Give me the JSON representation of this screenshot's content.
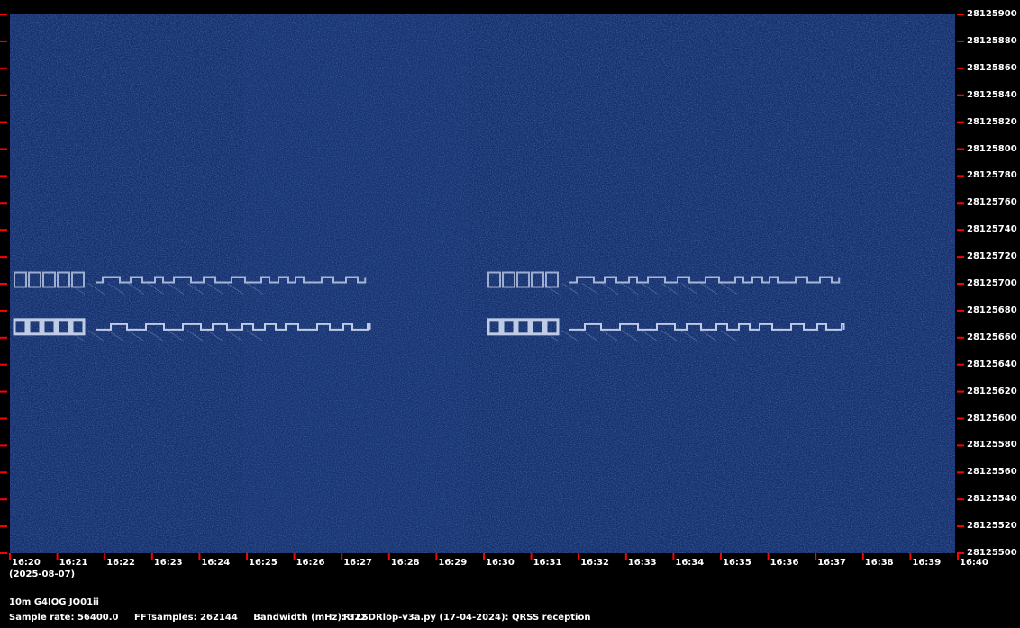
{
  "chart_data": {
    "type": "heatmap",
    "title": "",
    "xlabel": "",
    "ylabel": "",
    "x_tick_labels": [
      "16:20",
      "16:21",
      "16:22",
      "16:23",
      "16:24",
      "16:25",
      "16:26",
      "16:27",
      "16:28",
      "16:29",
      "16:30",
      "16:31",
      "16:32",
      "16:33",
      "16:34",
      "16:35",
      "16:36",
      "16:37",
      "16:38",
      "16:39",
      "16:40"
    ],
    "x_range": [
      "16:20",
      "16:40"
    ],
    "date": "(2025-08-07)",
    "y_tick_labels": [
      "28125900",
      "28125880",
      "28125860",
      "28125840",
      "28125820",
      "28125800",
      "28125780",
      "28125760",
      "28125740",
      "28125720",
      "28125700",
      "28125680",
      "28125660",
      "28125640",
      "28125620",
      "28125600",
      "28125580",
      "28125560",
      "28125540",
      "28125520",
      "28125500"
    ],
    "y_range": [
      28125500,
      28125900
    ],
    "background_colors": {
      "noise_base": "#16306e",
      "signal": "#c8d4ec",
      "tick_marks": "#ff0000",
      "page": "#000000"
    },
    "signals": [
      {
        "callsign_trace": "G0MBA",
        "frequency_hz": 28125703,
        "repeats_start": [
          "16:20",
          "16:30"
        ],
        "duration_min": 7.4
      },
      {
        "callsign_trace": "G0PKT",
        "frequency_hz": 28125668,
        "repeats_start": [
          "16:20",
          "16:30"
        ],
        "duration_min": 7.5
      }
    ]
  },
  "footer": {
    "station": "10m G4IOG JO01ii",
    "sample_rate": "Sample rate: 56400.0",
    "fft_samples": "FFTsamples: 262144",
    "bandwidth": "Bandwidth (mHz): 322",
    "software": "RTLSDRlop-v3a.py (17-04-2024): QRSS reception"
  }
}
